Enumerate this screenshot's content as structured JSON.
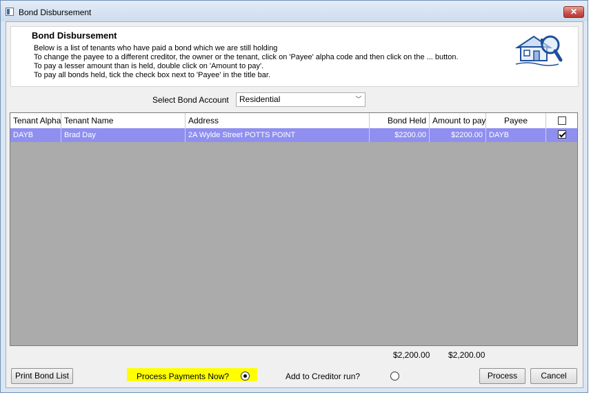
{
  "window": {
    "title": "Bond Disbursement",
    "close_glyph": "✕"
  },
  "header": {
    "title": "Bond Disbursement",
    "lines": [
      "Below is a list of tenants who have paid a bond which we are still holding",
      "To change the payee to a different creditor, the owner or the tenant, click on 'Payee' alpha code and then click on the ... button.",
      "To pay a lesser amount than is held, double click on 'Amount to pay'.",
      "To pay all bonds held, tick the check box next to 'Payee' in the title bar."
    ],
    "icon": "house-magnifier-icon"
  },
  "account": {
    "label": "Select Bond Account",
    "selected": "Residential",
    "chevron": "﹀"
  },
  "grid": {
    "columns": [
      "Tenant Alpha",
      "Tenant Name",
      "Address",
      "Bond Held",
      "Amount to pay",
      "Payee"
    ],
    "select_all_checked": false,
    "rows": [
      {
        "alpha": "DAYB",
        "name": "Brad Day",
        "address": "2A Wylde Street POTTS POINT",
        "bond_held": "$2200.00",
        "amount": "$2200.00",
        "payee": "DAYB",
        "checked": true
      }
    ]
  },
  "totals": {
    "bond_held": "$2,200.00",
    "amount": "$2,200.00"
  },
  "footer": {
    "print_label": "Print Bond List",
    "process_now_label": "Process Payments Now?",
    "creditor_run_label": "Add to Creditor run?",
    "process_label": "Process",
    "cancel_label": "Cancel"
  },
  "colors": {
    "selected_row": "#8f8ff0",
    "grid_background": "#ababab",
    "highlight": "#ffff00"
  }
}
